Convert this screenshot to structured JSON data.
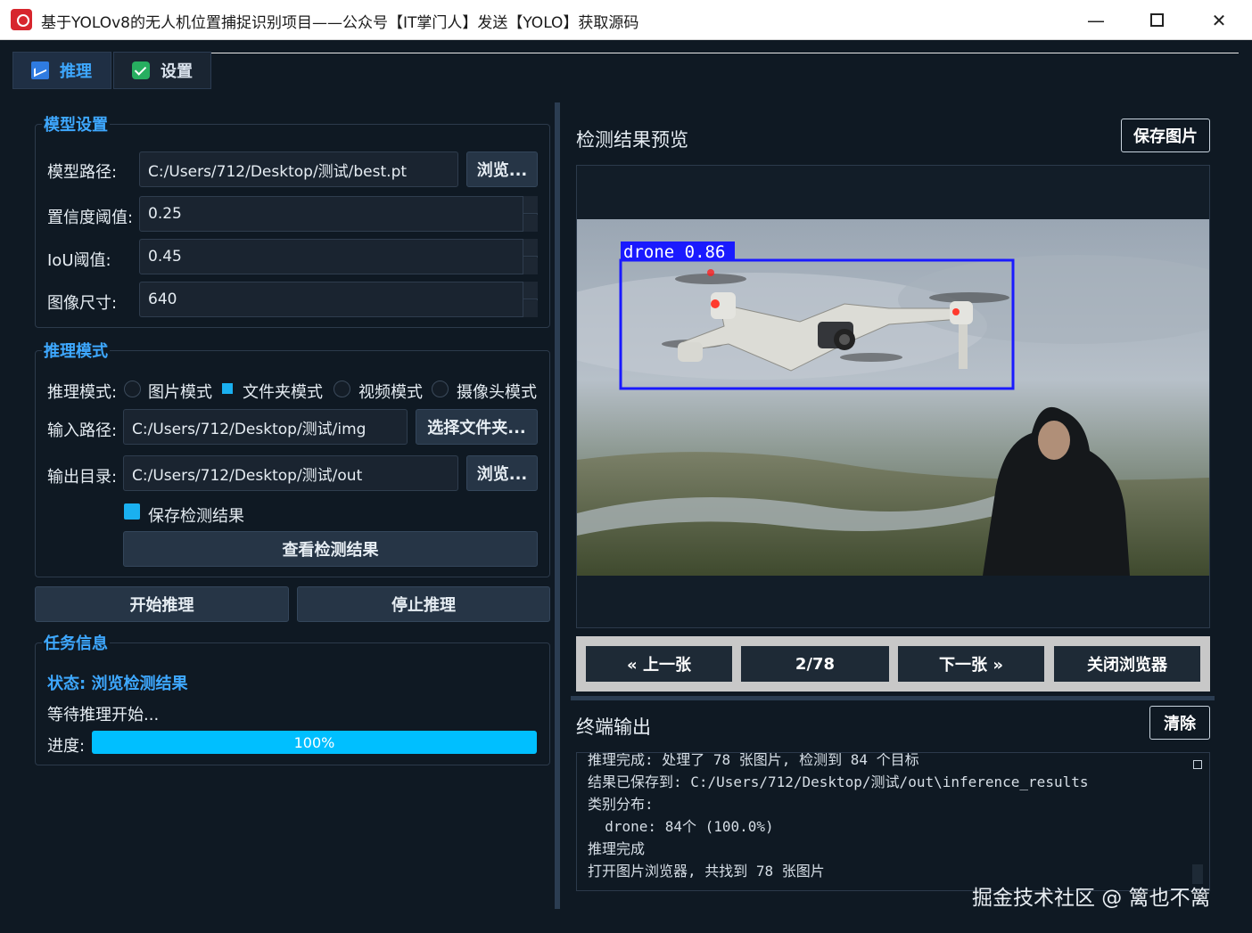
{
  "window": {
    "title": "基于YOLOv8的无人机位置捕捉识别项目——公众号【IT掌门人】发送【YOLO】获取源码",
    "min_glyph": "—",
    "close_glyph": "✕"
  },
  "tabs": [
    {
      "label": "推理",
      "icon": "chart-icon",
      "active": true
    },
    {
      "label": "设置",
      "icon": "check-icon",
      "active": false
    }
  ],
  "model_settings": {
    "title": "模型设置",
    "model_path_label": "模型路径:",
    "model_path_value": "C:/Users/712/Desktop/测试/best.pt",
    "browse_label": "浏览...",
    "conf_label": "置信度阈值:",
    "conf_value": "0.25",
    "iou_label": "IoU阈值:",
    "iou_value": "0.45",
    "imgsz_label": "图像尺寸:",
    "imgsz_value": "640"
  },
  "inference_mode": {
    "title": "推理模式",
    "mode_label": "推理模式:",
    "options": [
      "图片模式",
      "文件夹模式",
      "视频模式",
      "摄像头模式"
    ],
    "selected": "文件夹模式",
    "input_label": "输入路径:",
    "input_value": "C:/Users/712/Desktop/测试/img",
    "select_folder_label": "选择文件夹...",
    "output_label": "输出目录:",
    "output_value": "C:/Users/712/Desktop/测试/out",
    "browse_label": "浏览...",
    "save_results_label": "保存检测结果",
    "save_results_checked": true,
    "view_results_label": "查看检测结果"
  },
  "actions": {
    "start_label": "开始推理",
    "stop_label": "停止推理"
  },
  "task_info": {
    "title": "任务信息",
    "status": "状态: 浏览检测结果",
    "message": "等待推理开始...",
    "progress_label": "进度:",
    "progress_text": "100%",
    "progress": 1.0
  },
  "preview": {
    "title": "检测结果预览",
    "save_label": "保存图片",
    "detection_label": "drone  0.86",
    "colors": {
      "box": "#1a1aff",
      "label_bg": "#1a1aff"
    }
  },
  "navigation": {
    "prev_label": "« 上一张",
    "counter": "2/78",
    "next_label": "下一张 »",
    "close_label": "关闭浏览器"
  },
  "terminal": {
    "title": "终端输出",
    "clear_label": "清除",
    "lines": [
      "推理完成: 处理了 78 张图片, 检测到 84 个目标",
      "结果已保存到: C:/Users/712/Desktop/测试/out\\inference_results",
      "类别分布:",
      "  drone: 84个 (100.0%)",
      "推理完成",
      "打开图片浏览器, 共找到 78 张图片"
    ]
  },
  "watermark": "掘金技术社区 @ 篱也不篱"
}
